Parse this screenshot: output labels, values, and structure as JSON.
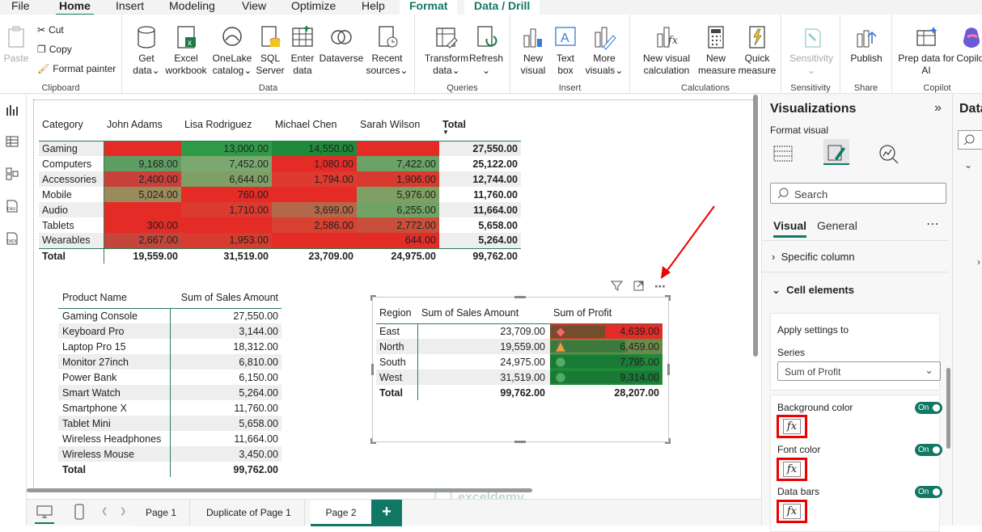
{
  "tabs": [
    "File",
    "Home",
    "Insert",
    "Modeling",
    "View",
    "Optimize",
    "Help",
    "Format",
    "Data / Drill"
  ],
  "ribbon": {
    "clipboard": {
      "paste": "Paste",
      "cut": "Cut",
      "copy": "Copy",
      "format_painter": "Format painter",
      "label": "Clipboard"
    },
    "data": {
      "label": "Data",
      "items": [
        "Get data",
        "Excel workbook",
        "OneLake catalog",
        "SQL Server",
        "Enter data",
        "Dataverse",
        "Recent sources"
      ]
    },
    "queries": {
      "label": "Queries",
      "items": [
        "Transform data",
        "Refresh"
      ]
    },
    "insert": {
      "label": "Insert",
      "items": [
        "New visual",
        "Text box",
        "More visuals"
      ]
    },
    "calculations": {
      "label": "Calculations",
      "items": [
        "New visual calculation",
        "New measure",
        "Quick measure"
      ]
    },
    "sensitivity": {
      "label": "Sensitivity",
      "items": [
        "Sensitivity"
      ]
    },
    "share": {
      "label": "Share",
      "items": [
        "Publish"
      ]
    },
    "copilot": {
      "label": "Copilot",
      "items": [
        "Prep data for AI",
        "Copilot"
      ]
    }
  },
  "matrix": {
    "headers": [
      "Category",
      "John Adams",
      "Lisa Rodriguez",
      "Michael Chen",
      "Sarah Wilson",
      "Total"
    ],
    "rows": [
      {
        "cat": "Gaming",
        "vals": [
          "",
          "13,000.00",
          "14,550.00",
          ""
        ],
        "total": "27,550.00",
        "colors": [
          "#e42b26",
          "#2f9a47",
          "#1e8a3a",
          "#e42b26"
        ]
      },
      {
        "cat": "Computers",
        "vals": [
          "9,168.00",
          "7,452.00",
          "1,080.00",
          "7,422.00"
        ],
        "total": "25,122.00",
        "colors": [
          "#5f9e62",
          "#7aa870",
          "#e42b26",
          "#6aa267"
        ]
      },
      {
        "cat": "Accessories",
        "vals": [
          "2,400.00",
          "6,644.00",
          "1,794.00",
          "1,906.00"
        ],
        "total": "12,744.00",
        "colors": [
          "#c9403a",
          "#7e9f66",
          "#dd3b2f",
          "#d83a30"
        ]
      },
      {
        "cat": "Mobile",
        "vals": [
          "5,024.00",
          "760.00",
          "",
          "5,976.00"
        ],
        "total": "11,760.00",
        "colors": [
          "#9b8a5a",
          "#e42b26",
          "#e42b26",
          "#7fa064"
        ]
      },
      {
        "cat": "Audio",
        "vals": [
          "",
          "1,710.00",
          "3,699.00",
          "6,255.00"
        ],
        "total": "11,664.00",
        "colors": [
          "#e42b26",
          "#dc3a2e",
          "#b46849",
          "#72a366"
        ]
      },
      {
        "cat": "Tablets",
        "vals": [
          "300.00",
          "",
          "2,586.00",
          "2,772.00"
        ],
        "total": "5,658.00",
        "colors": [
          "#e42b26",
          "#e42b26",
          "#d8402f",
          "#c8503a"
        ]
      },
      {
        "cat": "Wearables",
        "vals": [
          "2,667.00",
          "1,953.00",
          "",
          "644.00"
        ],
        "total": "5,264.00",
        "colors": [
          "#c4463a",
          "#d83c2f",
          "#e42b26",
          "#e42b26"
        ]
      }
    ],
    "total_row": {
      "label": "Total",
      "vals": [
        "19,559.00",
        "31,519.00",
        "23,709.00",
        "24,975.00"
      ],
      "total": "99,762.00"
    }
  },
  "products": {
    "headers": [
      "Product Name",
      "Sum of Sales Amount"
    ],
    "rows": [
      [
        "Gaming Console",
        "27,550.00"
      ],
      [
        "Keyboard Pro",
        "3,144.00"
      ],
      [
        "Laptop Pro 15",
        "18,312.00"
      ],
      [
        "Monitor 27inch",
        "6,810.00"
      ],
      [
        "Power Bank",
        "6,150.00"
      ],
      [
        "Smart Watch",
        "5,264.00"
      ],
      [
        "Smartphone X",
        "11,760.00"
      ],
      [
        "Tablet Mini",
        "5,658.00"
      ],
      [
        "Wireless Headphones",
        "11,664.00"
      ],
      [
        "Wireless Mouse",
        "3,450.00"
      ]
    ],
    "total": [
      "Total",
      "99,762.00"
    ]
  },
  "region": {
    "headers": [
      "Region",
      "Sum of Sales Amount",
      "Sum of Profit"
    ],
    "rows": [
      {
        "r": "East",
        "s": "23,709.00",
        "p": "4,639.00",
        "icon": "diamond",
        "bg": "#e42b26",
        "bar": 0.5
      },
      {
        "r": "North",
        "s": "19,559.00",
        "p": "6,459.00",
        "icon": "triangle",
        "bg": "#6b8a4a",
        "bar": 0.69
      },
      {
        "r": "South",
        "s": "24,975.00",
        "p": "7,795.00",
        "icon": "circle",
        "bg": "#1e8a3a",
        "bar": 0.84
      },
      {
        "r": "West",
        "s": "31,519.00",
        "p": "9,314.00",
        "icon": "circle",
        "bg": "#1e8a3a",
        "bar": 1.0
      }
    ],
    "total": [
      "Total",
      "99,762.00",
      "28,207.00"
    ]
  },
  "pages": [
    "Page 1",
    "Duplicate of Page 1",
    "Page 2"
  ],
  "vis": {
    "title": "Visualizations",
    "format_visual": "Format visual",
    "search_placeholder": "Search",
    "tab_visual": "Visual",
    "tab_general": "General",
    "specific_column": "Specific column",
    "cell_elements": "Cell elements",
    "apply_settings": "Apply settings to",
    "series_label": "Series",
    "series_value": "Sum of Profit",
    "background_color": "Background color",
    "font_color": "Font color",
    "data_bars": "Data bars",
    "on": "On",
    "fx": "fx"
  },
  "data_pane_title": "Data",
  "colors": {
    "accent": "#117865",
    "red_highlight": "#e00000"
  }
}
